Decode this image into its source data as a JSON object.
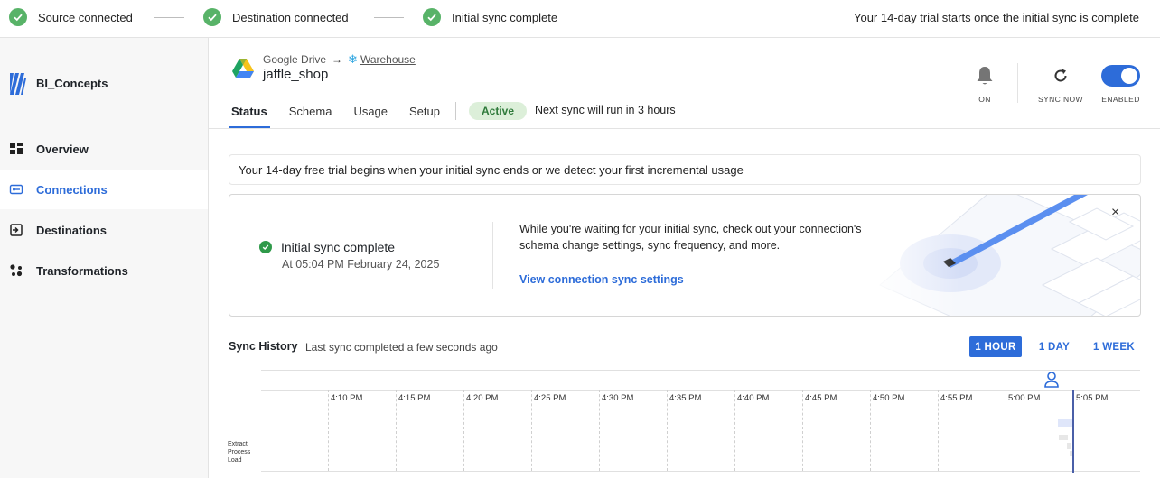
{
  "progress": {
    "steps": [
      {
        "label": "Source connected",
        "status": "complete"
      },
      {
        "label": "Destination connected",
        "status": "complete"
      },
      {
        "label": "Initial sync complete",
        "status": "complete"
      }
    ],
    "trial_note": "Your 14-day trial starts once the initial sync is complete"
  },
  "sidebar": {
    "brand": "BI_Concepts",
    "items": [
      {
        "label": "Overview",
        "icon": "dashboard-icon",
        "active": false
      },
      {
        "label": "Connections",
        "icon": "connections-icon",
        "active": true
      },
      {
        "label": "Destinations",
        "icon": "destinations-icon",
        "active": false
      },
      {
        "label": "Transformations",
        "icon": "transformations-icon",
        "active": false
      }
    ]
  },
  "header": {
    "source": "Google Drive",
    "destination": "Warehouse",
    "connection_name": "jaffle_shop",
    "tabs": [
      "Status",
      "Schema",
      "Usage",
      "Setup"
    ],
    "active_tab": "Status",
    "status_badge": "Active",
    "next_sync": "Next sync will run in 3 hours",
    "controls": {
      "notifications_label": "ON",
      "sync_now_label": "SYNC NOW",
      "enabled_label": "ENABLED",
      "enabled": true
    }
  },
  "banner": {
    "text": "Your 14-day free trial begins when your initial sync ends or we detect your first incremental usage"
  },
  "sync_card": {
    "title": "Initial sync complete",
    "timestamp": "At 05:04 PM February 24, 2025",
    "message": "While you're waiting for your initial sync, check out your connection's schema change settings, sync frequency, and more.",
    "link": "View connection sync settings",
    "close": "×"
  },
  "sync_history": {
    "title": "Sync History",
    "subtitle": "Last sync completed a few seconds ago",
    "ranges": [
      "1 HOUR",
      "1 DAY",
      "1 WEEK"
    ],
    "active_range": "1 HOUR",
    "time_labels": [
      "4:10 PM",
      "4:15 PM",
      "4:20 PM",
      "4:25 PM",
      "4:30 PM",
      "4:35 PM",
      "4:40 PM",
      "4:45 PM",
      "4:50 PM",
      "4:55 PM",
      "5:00 PM",
      "5:05 PM"
    ],
    "rows": [
      "Extract",
      "Process",
      "Load"
    ]
  },
  "colors": {
    "accent": "#2d6cd9",
    "success": "#58b368",
    "active_badge_bg": "#dcefd9",
    "active_badge_text": "#2e7a3a"
  }
}
